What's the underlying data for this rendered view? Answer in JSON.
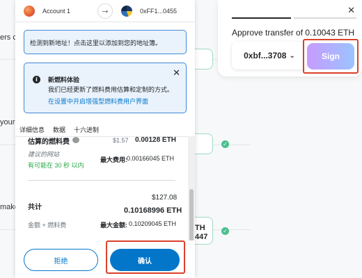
{
  "background": {
    "text_lines": [
      "ers ca",
      "your",
      "make"
    ],
    "amount_right": {
      "line1": "TH",
      "line2": "447"
    }
  },
  "approve_card": {
    "approve_text": "Approve transfer of 0.10043 ETH",
    "address": "0xbf...3708",
    "address_chevron": "⌵",
    "sign_label": "Sign",
    "close_icon": "close-icon"
  },
  "wallet": {
    "account_name": "Account 1",
    "dest_address": "0xFF1...0455",
    "arrow_glyph": "→",
    "notice_new_address": "检测到新地址！点击这里以添加到您的地址簿。",
    "notice_gas": {
      "title": "新燃料体验",
      "body": "我们已经更新了燃料费用估算和定制的方式。",
      "link": "在设置中开启增强型燃料费用户界面",
      "close": "✕"
    },
    "tabs": [
      "详细信息",
      "数据",
      "十六进制"
    ],
    "gas": {
      "partial_header": "估算的燃料费",
      "partial_usd": "$1.57",
      "partial_eth": "0.00128 ETH",
      "suggested_site": "建议的网站",
      "likely": "有可能在 30 秒 以内",
      "max_label": "最大费用:",
      "max_value": "0.00166045 ETH"
    },
    "total": {
      "label": "共计",
      "usd": "$127.08",
      "eth": "0.10168996 ETH",
      "sub_label": "金额 + 燃料费",
      "max_amount_label": "最大金额:",
      "max_amount_value": "0.10209045 ETH"
    },
    "reject_label": "拒绝",
    "confirm_label": "确认"
  },
  "colors": {
    "accent": "#0376c9",
    "highlight_box": "#d9412b",
    "success": "#28a745"
  }
}
